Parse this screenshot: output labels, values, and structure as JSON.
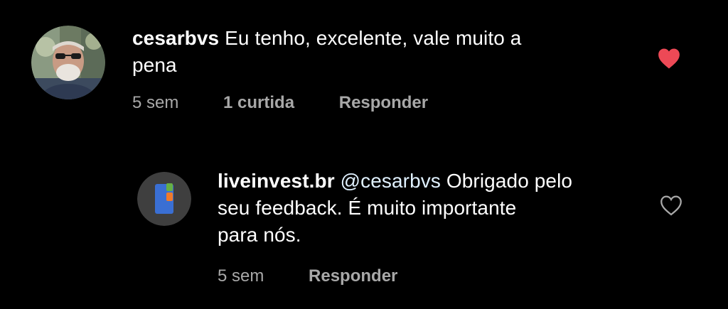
{
  "comments": [
    {
      "username": "cesarbvs",
      "text_line1": "Eu tenho, excelente, vale muito a",
      "text_line2": "pena",
      "time": "5 sem",
      "likes": "1 curtida",
      "reply_label": "Responder",
      "liked": true,
      "heart_icon": "heart-filled-icon",
      "heart_color": "#ed4956"
    },
    {
      "username": "liveinvest.br",
      "mention": "@cesarbvs",
      "text_line1": "Obrigado pelo",
      "text_line2": "seu feedback. É muito importante",
      "text_line3": "para nós.",
      "time": "5 sem",
      "reply_label": "Responder",
      "liked": false,
      "heart_icon": "heart-outline-icon"
    }
  ],
  "colors": {
    "background": "#000000",
    "text": "#ffffff",
    "meta_text": "#a8a8a8",
    "mention": "#e0f1ff",
    "like_red": "#ed4956"
  }
}
